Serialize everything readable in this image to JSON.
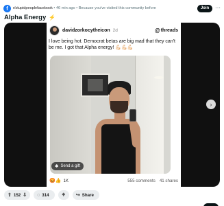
{
  "post": {
    "subreddit": "r/stupidpeoplefacebook",
    "age": "46 min ago",
    "reason": "Because you've visited this community before",
    "join_label": "Join",
    "title": "Alpha Energy",
    "flair_icon": "lightning-icon"
  },
  "card": {
    "username": "davidzorkocytheicon",
    "verified_icon": "verified-badge-icon",
    "time": "2d",
    "platform": "threads",
    "text": "I love being hot. Democrat betas are big mad that they can't be me. I got that Alpha energy! 💪🏻💪🏻💪🏻",
    "send_gift_label": "Send a gift",
    "reaction_count": "1K",
    "comments": "555 comments",
    "shares": "41 shares"
  },
  "actions": {
    "votes": "152",
    "comments": "314",
    "share_label": "Share"
  },
  "colors": {
    "join_bg": "#0a1416",
    "pill_bg": "#eaedef",
    "subreddit_icon": "#1877f2"
  }
}
